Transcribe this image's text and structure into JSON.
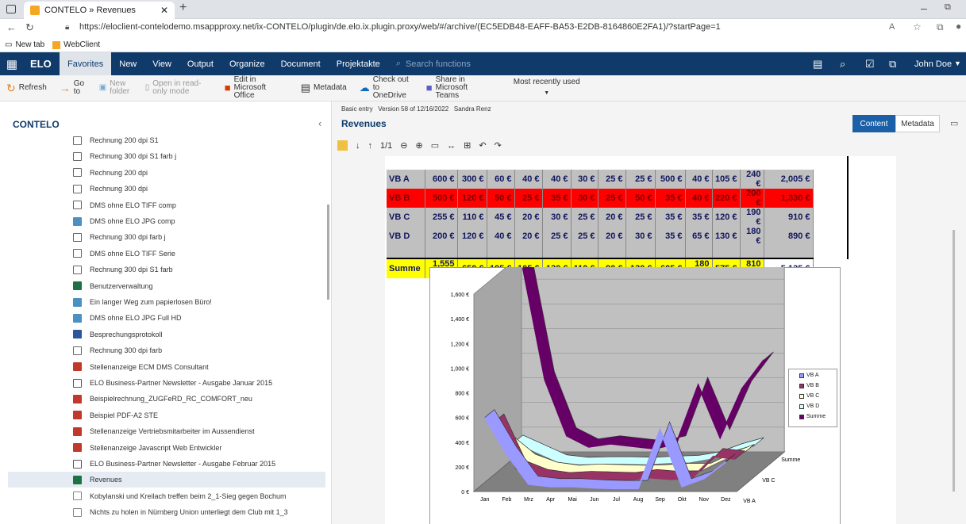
{
  "browser": {
    "tab_title": "CONTELO » Revenues",
    "url": "https://eloclient-contelodemo.msappproxy.net/ix-CONTELO/plugin/de.elo.ix.plugin.proxy/web/#/archive/(EC5EDB48-EAFF-BA53-E2DB-8164860E2FA1)/?startPage=1",
    "favorites": [
      "New tab",
      "WebClient"
    ]
  },
  "ribbon": {
    "logo": "ELO",
    "tabs": [
      "Favorites",
      "New",
      "View",
      "Output",
      "Organize",
      "Document",
      "Projektakte"
    ],
    "search_placeholder": "Search functions",
    "user": "John Doe"
  },
  "toolbar": {
    "items": [
      "Refresh",
      "Go to",
      "New folder",
      "Open in read-only mode",
      "Edit in Microsoft Office",
      "Metadata",
      "Check out to OneDrive",
      "Share in Microsoft Teams",
      "Most recently used"
    ]
  },
  "sidebar": {
    "title": "CONTELO",
    "items": [
      {
        "label": "Rechnung 200 dpi S1",
        "type": "doc"
      },
      {
        "label": "Rechnung 300 dpi S1 farb j",
        "type": "doc"
      },
      {
        "label": "Rechnung 200 dpi",
        "type": "doc"
      },
      {
        "label": "Rechnung 300 dpi",
        "type": "doc"
      },
      {
        "label": "DMS ohne ELO TIFF comp",
        "type": "doc"
      },
      {
        "label": "DMS ohne ELO JPG comp",
        "type": "img"
      },
      {
        "label": "Rechnung 300 dpi farb j",
        "type": "doc"
      },
      {
        "label": "DMS ohne ELO TIFF Serie",
        "type": "doc"
      },
      {
        "label": "Rechnung 300 dpi S1 farb",
        "type": "doc"
      },
      {
        "label": "Benutzerverwaltung",
        "type": "xls"
      },
      {
        "label": "Ein langer Weg zum papierlosen Büro!",
        "type": "img"
      },
      {
        "label": "DMS ohne ELO JPG Full HD",
        "type": "img"
      },
      {
        "label": "Besprechungsprotokoll",
        "type": "word"
      },
      {
        "label": "Rechnung 300 dpi farb",
        "type": "doc"
      },
      {
        "label": "Stellenanzeige ECM DMS Consultant",
        "type": "pdf"
      },
      {
        "label": "ELO Business-Partner Newsletter - Ausgabe Januar 2015",
        "type": "mail"
      },
      {
        "label": "Beispielrechnung_ZUGFeRD_RC_COMFORT_neu",
        "type": "pdf"
      },
      {
        "label": "Beispiel PDF-A2 STE",
        "type": "pdf"
      },
      {
        "label": "Stellenanzeige Vertriebsmitarbeiter im Aussendienst",
        "type": "pdf"
      },
      {
        "label": "Stellenanzeige Javascript Web Entwickler",
        "type": "pdf"
      },
      {
        "label": "ELO Business-Partner Newsletter - Ausgabe Februar 2015",
        "type": "mail"
      },
      {
        "label": "Revenues",
        "type": "xls",
        "selected": true
      },
      {
        "label": "Kobylanski und Kreilach treffen beim 2_1-Sieg gegen Bochum",
        "type": "txt"
      },
      {
        "label": "Nichts zu holen in Nürnberg Union unterliegt dem Club mit 1_3",
        "type": "txt"
      }
    ]
  },
  "viewer": {
    "meta_line": "Basic entry   Version 58 of 12/16/2022   Sandra Renz",
    "title": "Revenues",
    "tab_content": "Content",
    "tab_metadata": "Metadata",
    "page": "1/1"
  },
  "sheet": {
    "rows": [
      {
        "label": "VB A",
        "values": [
          "600 €",
          "300 €",
          "60 €",
          "40 €",
          "40 €",
          "30 €",
          "25 €",
          "25 €",
          "500 €",
          "40 €",
          "105 €",
          "240 €"
        ],
        "total": "2,005 €",
        "bg": "#c0c0c0",
        "fg": "#11165c"
      },
      {
        "label": "VB B",
        "values": [
          "500 €",
          "120 €",
          "50 €",
          "25 €",
          "35 €",
          "30 €",
          "25 €",
          "50 €",
          "35 €",
          "40 €",
          "220 €",
          "200 €"
        ],
        "total": "1,330 €",
        "bg": "#ff0000",
        "fg": "#7a0000"
      },
      {
        "label": "VB C",
        "values": [
          "255 €",
          "110 €",
          "45 €",
          "20 €",
          "30 €",
          "25 €",
          "20 €",
          "25 €",
          "35 €",
          "35 €",
          "120 €",
          "190 €"
        ],
        "total": "910 €",
        "bg": "#c0c0c0",
        "fg": "#11165c"
      },
      {
        "label": "VB D",
        "values": [
          "200 €",
          "120 €",
          "40 €",
          "20 €",
          "25 €",
          "25 €",
          "20 €",
          "30 €",
          "35 €",
          "65 €",
          "130 €",
          "180 €"
        ],
        "total": "890 €",
        "bg": "#c0c0c0",
        "fg": "#11165c"
      }
    ],
    "sum": {
      "label": "Summe",
      "values": [
        "1,555 €",
        "650 €",
        "195 €",
        "105 €",
        "130 €",
        "110 €",
        "90 €",
        "130 €",
        "605 €",
        "180 €",
        "575 €",
        "810 €"
      ],
      "total": "5,135 €"
    }
  },
  "chart_data": {
    "type": "line",
    "categories": [
      "Jan",
      "Feb",
      "Mrz",
      "Apr",
      "Mai",
      "Jun",
      "Jul",
      "Aug",
      "Sep",
      "Okt",
      "Nov",
      "Dez"
    ],
    "y_ticks": [
      "0 €",
      "200 €",
      "400 €",
      "600 €",
      "800 €",
      "1,000 €",
      "1,200 €",
      "1,400 €",
      "1,600 €"
    ],
    "ylim": [
      0,
      1600
    ],
    "series": [
      {
        "name": "VB A",
        "values": [
          600,
          300,
          60,
          40,
          40,
          30,
          25,
          25,
          500,
          40,
          105,
          240
        ],
        "color": "#9999ff"
      },
      {
        "name": "VB B",
        "values": [
          500,
          120,
          50,
          25,
          35,
          30,
          25,
          50,
          35,
          40,
          220,
          200
        ],
        "color": "#993366"
      },
      {
        "name": "VB C",
        "values": [
          255,
          110,
          45,
          20,
          30,
          25,
          20,
          25,
          35,
          35,
          120,
          190
        ],
        "color": "#ffffcc"
      },
      {
        "name": "VB D",
        "values": [
          200,
          120,
          40,
          20,
          25,
          25,
          20,
          30,
          35,
          65,
          130,
          180
        ],
        "color": "#ccffff"
      },
      {
        "name": "Summe",
        "values": [
          1555,
          650,
          195,
          105,
          130,
          110,
          90,
          130,
          605,
          180,
          575,
          810
        ],
        "color": "#660066"
      }
    ],
    "depth_labels": [
      "Summe",
      "VB C",
      "VB A"
    ]
  }
}
